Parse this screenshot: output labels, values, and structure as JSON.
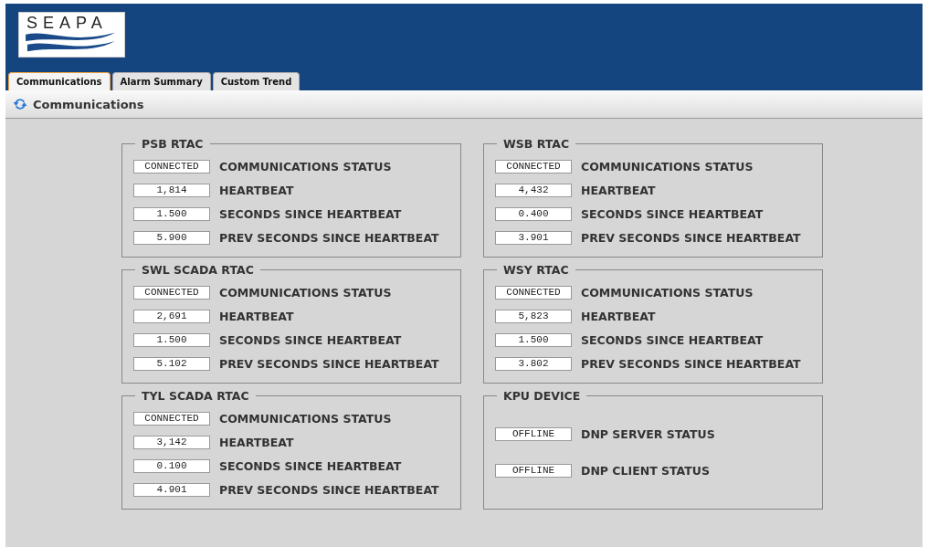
{
  "logo": {
    "text": "SEAPA"
  },
  "tabs": [
    {
      "label": "Communications",
      "selected": true
    },
    {
      "label": "Alarm Summary",
      "selected": false
    },
    {
      "label": "Custom Trend",
      "selected": false
    }
  ],
  "toolbar": {
    "title": "Communications"
  },
  "groups": [
    {
      "title": "PSB RTAC",
      "kind": "rtac",
      "rows": [
        {
          "value": "CONNECTED",
          "label": "COMMUNICATIONS STATUS"
        },
        {
          "value": "1,814",
          "label": "HEARTBEAT"
        },
        {
          "value": "1.500",
          "label": "SECONDS SINCE HEARTBEAT"
        },
        {
          "value": "5.900",
          "label": "PREV SECONDS SINCE HEARTBEAT"
        }
      ]
    },
    {
      "title": "WSB RTAC",
      "kind": "rtac",
      "rows": [
        {
          "value": "CONNECTED",
          "label": "COMMUNICATIONS STATUS"
        },
        {
          "value": "4,432",
          "label": "HEARTBEAT"
        },
        {
          "value": "0.400",
          "label": "SECONDS SINCE HEARTBEAT"
        },
        {
          "value": "3.901",
          "label": "PREV SECONDS SINCE HEARTBEAT"
        }
      ]
    },
    {
      "title": "SWL SCADA RTAC",
      "kind": "rtac",
      "rows": [
        {
          "value": "CONNECTED",
          "label": "COMMUNICATIONS STATUS"
        },
        {
          "value": "2,691",
          "label": "HEARTBEAT"
        },
        {
          "value": "1.500",
          "label": "SECONDS SINCE HEARTBEAT"
        },
        {
          "value": "5.102",
          "label": "PREV SECONDS SINCE HEARTBEAT"
        }
      ]
    },
    {
      "title": "WSY RTAC",
      "kind": "rtac",
      "rows": [
        {
          "value": "CONNECTED",
          "label": "COMMUNICATIONS STATUS"
        },
        {
          "value": "5,823",
          "label": "HEARTBEAT"
        },
        {
          "value": "1.500",
          "label": "SECONDS SINCE HEARTBEAT"
        },
        {
          "value": "3.802",
          "label": "PREV SECONDS SINCE HEARTBEAT"
        }
      ]
    },
    {
      "title": "TYL SCADA RTAC",
      "kind": "rtac",
      "rows": [
        {
          "value": "CONNECTED",
          "label": "COMMUNICATIONS STATUS"
        },
        {
          "value": "3,142",
          "label": "HEARTBEAT"
        },
        {
          "value": "0.100",
          "label": "SECONDS SINCE HEARTBEAT"
        },
        {
          "value": "4.901",
          "label": "PREV SECONDS SINCE HEARTBEAT"
        }
      ]
    },
    {
      "title": "KPU DEVICE",
      "kind": "device",
      "rows": [
        {
          "value": "OFFLINE",
          "label": "DNP SERVER STATUS"
        },
        {
          "value": "OFFLINE",
          "label": "DNP CLIENT STATUS"
        }
      ]
    }
  ]
}
